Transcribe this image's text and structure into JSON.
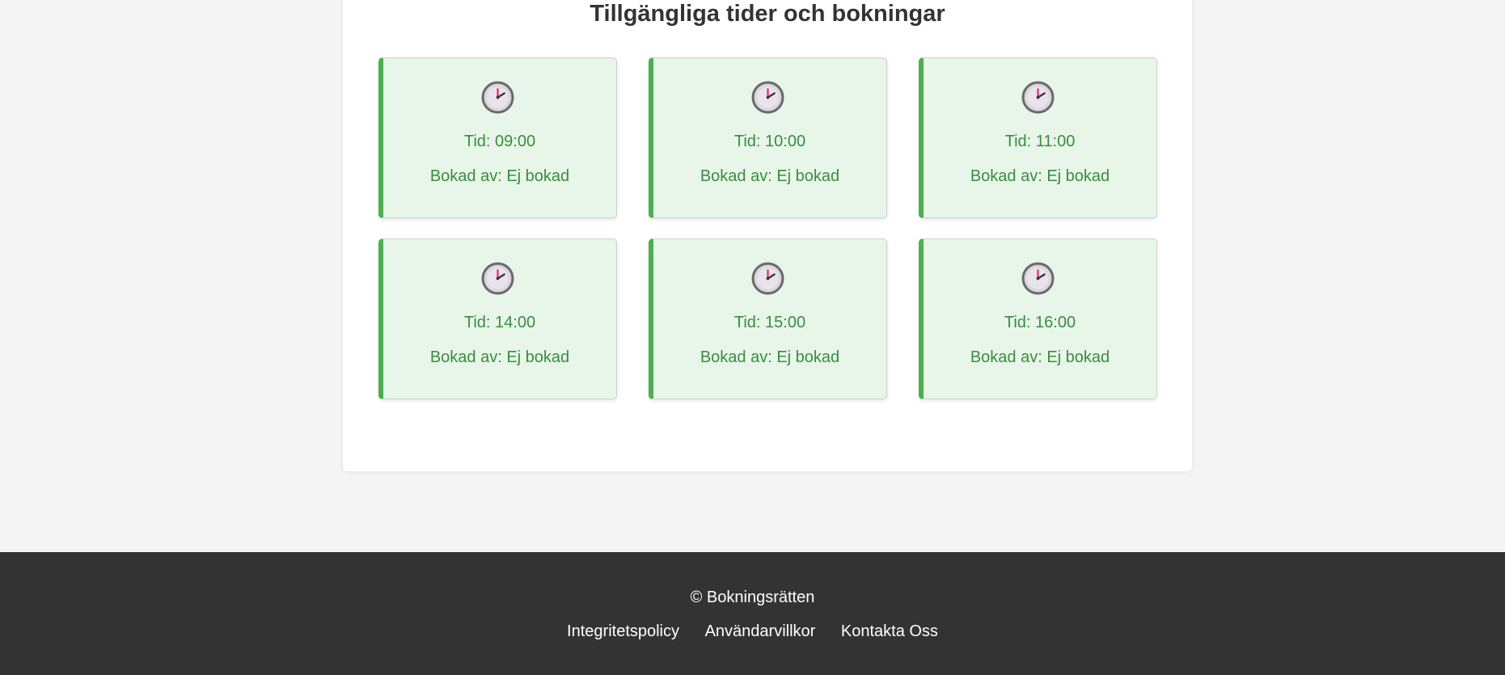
{
  "page": {
    "title": "Tillgängliga tider och bokningar"
  },
  "slots": [
    {
      "time_label": "Tid: 09:00",
      "booked_label": "Bokad av: Ej bokad"
    },
    {
      "time_label": "Tid: 10:00",
      "booked_label": "Bokad av: Ej bokad"
    },
    {
      "time_label": "Tid: 11:00",
      "booked_label": "Bokad av: Ej bokad"
    },
    {
      "time_label": "Tid: 14:00",
      "booked_label": "Bokad av: Ej bokad"
    },
    {
      "time_label": "Tid: 15:00",
      "booked_label": "Bokad av: Ej bokad"
    },
    {
      "time_label": "Tid: 16:00",
      "booked_label": "Bokad av: Ej bokad"
    }
  ],
  "slot_icon": "clock-icon",
  "colors": {
    "available_bg": "#e8f5e9",
    "available_accent": "#4caf50",
    "available_text": "#388e3c",
    "footer_bg": "#333333"
  },
  "footer": {
    "copyright": "© Bokningsrätten",
    "links": [
      "Integritetspolicy",
      "Användarvillkor",
      "Kontakta Oss"
    ]
  }
}
